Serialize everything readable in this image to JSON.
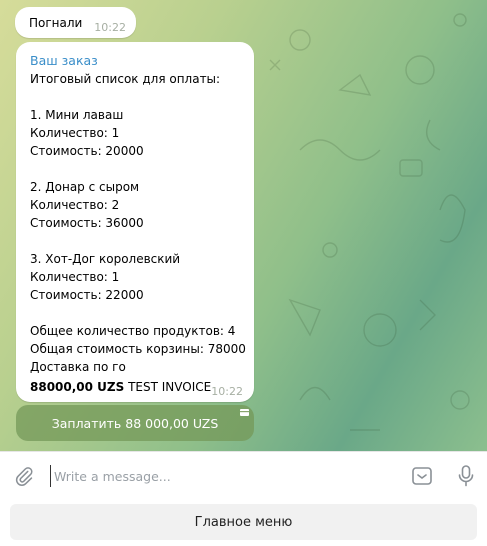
{
  "messages": {
    "first": {
      "text": "Погнали",
      "time": "10:22"
    },
    "invoice": {
      "sender": "Ваш заказ",
      "lines": [
        "Итоговый список для оплаты:",
        "",
        "1. Мини лаваш",
        "Количество: 1",
        "Стоимость: 20000",
        "",
        "2. Донар с сыром",
        "Количество: 2",
        "Стоимость: 36000",
        "",
        "3. Хот-Дог королевский",
        "Количество: 1",
        "Стоимость: 22000",
        "",
        "Общее количество продуктов: 4",
        "Общая стоимость корзины: 78000",
        "Доставка по го"
      ],
      "amount": "88000,00 UZS",
      "invoice_label": " TEST INVOICE",
      "time": "10:22"
    },
    "pay_button": "Заплатить 88 000,00 UZS"
  },
  "composer": {
    "placeholder": "Write a message..."
  },
  "keyboard": {
    "main_menu": "Главное меню"
  },
  "icons": {
    "attach": "paperclip-icon",
    "keyboard": "bot-keyboard-icon",
    "mic": "microphone-icon",
    "pay": "credit-card-icon"
  },
  "colors": {
    "sender": "#3a8ec9",
    "pay_button": "#749858",
    "time": "#a7afa3"
  }
}
